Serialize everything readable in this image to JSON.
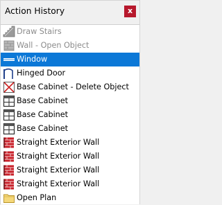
{
  "panel": {
    "title": "Action History",
    "close_label": "x"
  },
  "items": [
    {
      "label": "Draw Stairs",
      "icon": "stairs-icon",
      "state": "disabled"
    },
    {
      "label": "Wall - Open Object",
      "icon": "wall-icon",
      "state": "disabled"
    },
    {
      "label": "Window",
      "icon": "window-icon",
      "state": "selected"
    },
    {
      "label": "Hinged Door",
      "icon": "hinged-door-icon",
      "state": "normal"
    },
    {
      "label": "Base Cabinet - Delete Object",
      "icon": "delete-object-icon",
      "state": "normal"
    },
    {
      "label": "Base Cabinet",
      "icon": "base-cabinet-icon",
      "state": "normal"
    },
    {
      "label": "Base Cabinet",
      "icon": "base-cabinet-icon",
      "state": "normal"
    },
    {
      "label": "Base Cabinet",
      "icon": "base-cabinet-icon",
      "state": "normal"
    },
    {
      "label": "Straight Exterior Wall",
      "icon": "exterior-wall-icon",
      "state": "normal"
    },
    {
      "label": "Straight Exterior Wall",
      "icon": "exterior-wall-icon",
      "state": "normal"
    },
    {
      "label": "Straight Exterior Wall",
      "icon": "exterior-wall-icon",
      "state": "normal"
    },
    {
      "label": "Straight Exterior Wall",
      "icon": "exterior-wall-icon",
      "state": "normal"
    },
    {
      "label": "Open Plan",
      "icon": "folder-icon",
      "state": "normal"
    }
  ],
  "colors": {
    "selection": "#0c78d7",
    "close_button": "#b7182c",
    "disabled_text": "#8c8c8c"
  }
}
